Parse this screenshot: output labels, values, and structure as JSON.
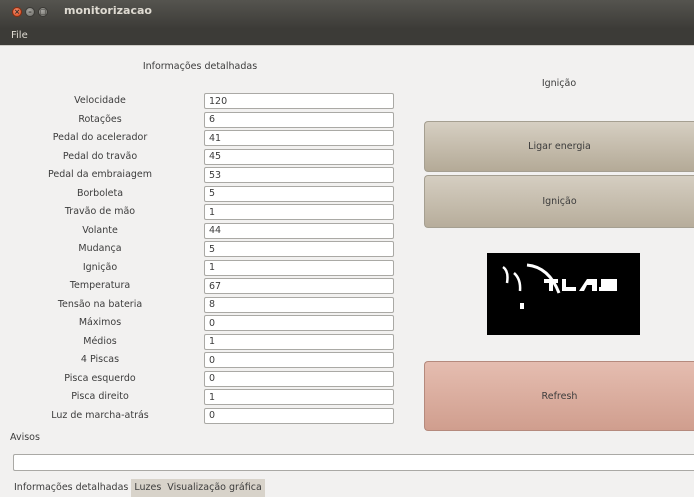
{
  "window": {
    "title": "monitorizacao",
    "menu": [
      "File"
    ]
  },
  "details": {
    "header": "Informações detalhadas",
    "fields": [
      {
        "label": "Velocidade",
        "value": "120"
      },
      {
        "label": "Rotações",
        "value": "6"
      },
      {
        "label": "Pedal do acelerador",
        "value": "41"
      },
      {
        "label": "Pedal do travão",
        "value": "45"
      },
      {
        "label": "Pedal da embraiagem",
        "value": "53"
      },
      {
        "label": "Borboleta",
        "value": "5"
      },
      {
        "label": "Travão de mão",
        "value": "1"
      },
      {
        "label": "Volante",
        "value": "44"
      },
      {
        "label": "Mudança",
        "value": "5"
      },
      {
        "label": "Ignição",
        "value": "1"
      },
      {
        "label": "Temperatura",
        "value": "67"
      },
      {
        "label": "Tensão na bateria",
        "value": "8"
      },
      {
        "label": "Máximos",
        "value": "0"
      },
      {
        "label": "Médios",
        "value": "1"
      },
      {
        "label": "4 Piscas",
        "value": "0"
      },
      {
        "label": "Pisca esquerdo",
        "value": "0"
      },
      {
        "label": "Pisca direito",
        "value": "1"
      },
      {
        "label": "Luz de marcha-atrás",
        "value": "0"
      }
    ]
  },
  "ignition": {
    "header": "Ignição",
    "power_button": "Ligar energia",
    "ignition_button": "Ignição",
    "refresh_button": "Refresh"
  },
  "avisos": {
    "label": "Avisos",
    "value": ""
  },
  "tabs": [
    {
      "label": "Informações detalhadas",
      "active": true
    },
    {
      "label": "Luzes",
      "active": false
    },
    {
      "label": "Visualização gráfica",
      "active": false
    }
  ],
  "colors": {
    "titlebar": "#3c3b37",
    "button": "#c6bdae",
    "refresh_button": "#dcae9f",
    "logo_bg": "#000000"
  }
}
